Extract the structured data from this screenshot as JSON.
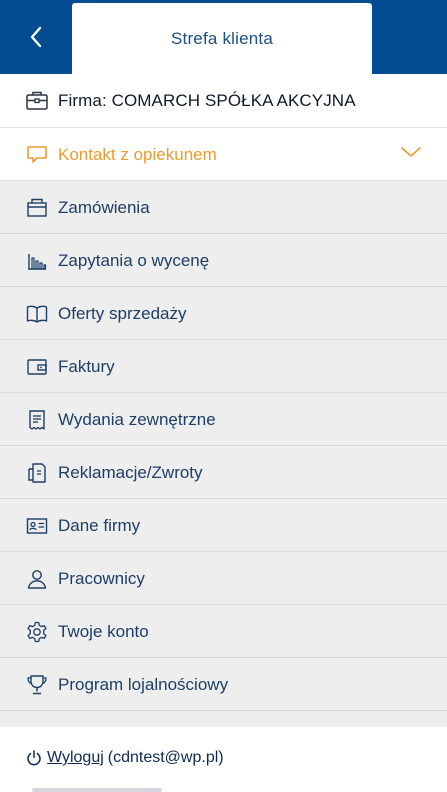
{
  "header": {
    "back_icon": "chevron-left-icon",
    "tab_title": "Strefa klienta"
  },
  "firm": {
    "icon": "briefcase-icon",
    "label": "Firma: COMARCH SPÓŁKA AKCYJNA"
  },
  "contact": {
    "icon": "speech-bubble-icon",
    "label": "Kontakt z opiekunem",
    "expand_icon": "chevron-down-icon",
    "accent_color": "#ee9a2f"
  },
  "menu": {
    "items": [
      {
        "label": "Zamówienia",
        "icon": "package-icon"
      },
      {
        "label": "Zapytania o wycenę",
        "icon": "bar-chart-icon"
      },
      {
        "label": "Oferty sprzedaży",
        "icon": "open-book-icon"
      },
      {
        "label": "Faktury",
        "icon": "wallet-icon"
      },
      {
        "label": "Wydania zewnętrzne",
        "icon": "receipt-icon"
      },
      {
        "label": "Reklamacje/Zwroty",
        "icon": "document-return-icon"
      },
      {
        "label": "Dane firmy",
        "icon": "id-card-icon"
      },
      {
        "label": "Pracownicy",
        "icon": "person-icon"
      },
      {
        "label": "Twoje konto",
        "icon": "gear-icon"
      },
      {
        "label": "Program lojalnościowy",
        "icon": "trophy-icon"
      }
    ]
  },
  "footer": {
    "logout_icon": "power-icon",
    "logout_label": "Wyloguj",
    "logout_user": "(cdntest@wp.pl)"
  },
  "colors": {
    "brand_blue": "#034c92",
    "menu_bg": "#eeeeee",
    "text_navy": "#1d3e66"
  }
}
